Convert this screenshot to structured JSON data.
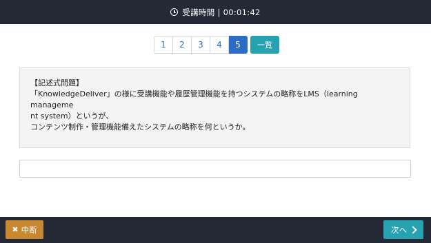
{
  "header": {
    "label": "受講時間",
    "separator": "|",
    "elapsed": "00:01:42"
  },
  "pager": {
    "pages": [
      "1",
      "2",
      "3",
      "4",
      "5"
    ],
    "current": "5",
    "list_label": "一覧"
  },
  "question": {
    "type_label": "【記述式問題】",
    "lines": [
      "「KnowledgeDeliver」の様に受講機能や履歴管理機能を持つシステムの略称をLMS（learning manageme",
      "nt system）というが、",
      "コンテンツ制作・管理機能備えたシステムの略称を何というか。"
    ]
  },
  "answer": {
    "value": "",
    "placeholder": ""
  },
  "footer": {
    "suspend_label": "中断",
    "next_label": "次へ"
  },
  "colors": {
    "topbar": "#232a35",
    "page_active": "#2b6cc4",
    "list_button": "#26a2b0",
    "suspend_button": "#c9872f",
    "next_button": "#26a2b0"
  },
  "icons": {
    "timer": "clock-icon",
    "suspend": "close-icon",
    "next": "chevron-right-icon"
  }
}
